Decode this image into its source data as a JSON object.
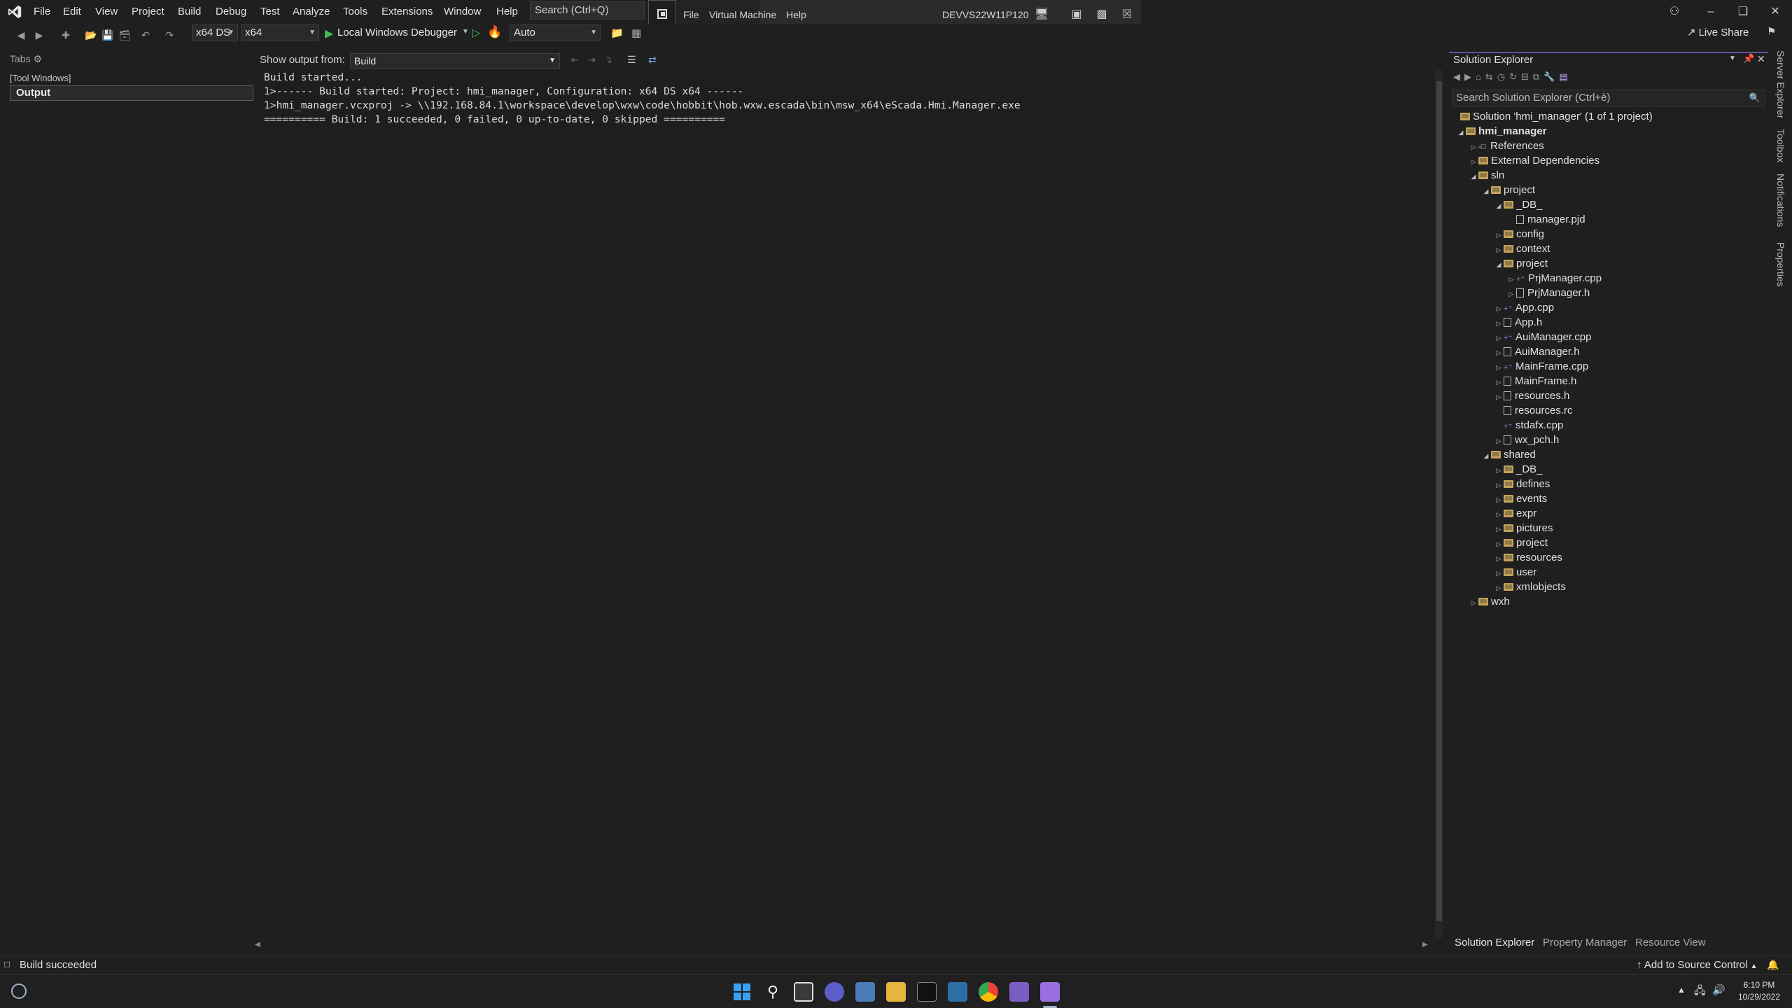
{
  "menu": [
    "File",
    "Edit",
    "View",
    "Project",
    "Build",
    "Debug",
    "Test",
    "Analyze",
    "Tools",
    "Extensions",
    "Window",
    "Help"
  ],
  "search": {
    "placeholder": "Search (Ctrl+Q)"
  },
  "vm_bar": {
    "items": [
      "File",
      "Virtual Machine",
      "Help"
    ],
    "machine_name": "DEVVS22W11P120"
  },
  "toolbar": {
    "config": "x64 DS",
    "platform": "x64",
    "debugger": "Local Windows Debugger",
    "mode": "Auto",
    "live_share": "Live Share"
  },
  "tabs_panel": {
    "title": "Tabs",
    "items": [
      "[Tool Windows]",
      "Output"
    ]
  },
  "output": {
    "show_from_label": "Show output from:",
    "source": "Build",
    "lines": [
      "Build started...",
      "1>------ Build started: Project: hmi_manager, Configuration: x64 DS x64 ------",
      "1>hmi_manager.vcxproj -> \\\\192.168.84.1\\workspace\\develop\\wxw\\code\\hobbit\\hob.wxw.escada\\bin\\msw_x64\\eScada.Hmi.Manager.exe",
      "========== Build: 1 succeeded, 0 failed, 0 up-to-date, 0 skipped =========="
    ]
  },
  "solution_explorer": {
    "title": "Solution Explorer",
    "search_placeholder": "Search Solution Explorer (Ctrl+è)",
    "tree": [
      {
        "label": "Solution 'hmi_manager' (1 of 1 project)",
        "indent": 0,
        "type": "solution",
        "expand": ""
      },
      {
        "label": "hmi_manager",
        "indent": 0,
        "type": "project",
        "expand": "open",
        "bold": true
      },
      {
        "label": "References",
        "indent": 1,
        "type": "ref",
        "expand": "closed"
      },
      {
        "label": "External Dependencies",
        "indent": 1,
        "type": "folder",
        "expand": "closed"
      },
      {
        "label": "sln",
        "indent": 1,
        "type": "folder",
        "expand": "open"
      },
      {
        "label": "project",
        "indent": 2,
        "type": "folder",
        "expand": "open"
      },
      {
        "label": "_DB_",
        "indent": 3,
        "type": "folder",
        "expand": "open"
      },
      {
        "label": "manager.pjd",
        "indent": 4,
        "type": "file",
        "expand": ""
      },
      {
        "label": "config",
        "indent": 3,
        "type": "folder",
        "expand": "closed"
      },
      {
        "label": "context",
        "indent": 3,
        "type": "folder",
        "expand": "closed"
      },
      {
        "label": "project",
        "indent": 3,
        "type": "folder",
        "expand": "open"
      },
      {
        "label": "PrjManager.cpp",
        "indent": 4,
        "type": "cpp",
        "expand": "closed"
      },
      {
        "label": "PrjManager.h",
        "indent": 4,
        "type": "file",
        "expand": "closed"
      },
      {
        "label": "App.cpp",
        "indent": 3,
        "type": "cpp",
        "expand": "closed"
      },
      {
        "label": "App.h",
        "indent": 3,
        "type": "file",
        "expand": "closed"
      },
      {
        "label": "AuiManager.cpp",
        "indent": 3,
        "type": "cpp",
        "expand": "closed"
      },
      {
        "label": "AuiManager.h",
        "indent": 3,
        "type": "file",
        "expand": "closed"
      },
      {
        "label": "MainFrame.cpp",
        "indent": 3,
        "type": "cpp",
        "expand": "closed"
      },
      {
        "label": "MainFrame.h",
        "indent": 3,
        "type": "file",
        "expand": "closed"
      },
      {
        "label": "resources.h",
        "indent": 3,
        "type": "file",
        "expand": "closed"
      },
      {
        "label": "resources.rc",
        "indent": 3,
        "type": "file",
        "expand": ""
      },
      {
        "label": "stdafx.cpp",
        "indent": 3,
        "type": "cpp",
        "expand": ""
      },
      {
        "label": "wx_pch.h",
        "indent": 3,
        "type": "file",
        "expand": "closed"
      },
      {
        "label": "shared",
        "indent": 2,
        "type": "folder",
        "expand": "open"
      },
      {
        "label": "_DB_",
        "indent": 3,
        "type": "folder",
        "expand": "closed"
      },
      {
        "label": "defines",
        "indent": 3,
        "type": "folder",
        "expand": "closed"
      },
      {
        "label": "events",
        "indent": 3,
        "type": "folder",
        "expand": "closed"
      },
      {
        "label": "expr",
        "indent": 3,
        "type": "folder",
        "expand": "closed"
      },
      {
        "label": "pictures",
        "indent": 3,
        "type": "folder",
        "expand": "closed"
      },
      {
        "label": "project",
        "indent": 3,
        "type": "folder",
        "expand": "closed"
      },
      {
        "label": "resources",
        "indent": 3,
        "type": "folder",
        "expand": "closed"
      },
      {
        "label": "user",
        "indent": 3,
        "type": "folder",
        "expand": "closed"
      },
      {
        "label": "xmlobjects",
        "indent": 3,
        "type": "folder",
        "expand": "closed"
      },
      {
        "label": "wxh",
        "indent": 1,
        "type": "folder",
        "expand": "closed"
      }
    ],
    "bottom_tabs": [
      "Solution Explorer",
      "Property Manager",
      "Resource View"
    ]
  },
  "right_rail": [
    "Server Explorer",
    "Toolbox",
    "Notifications",
    "Properties"
  ],
  "status": {
    "text": "Build succeeded",
    "source_control": "Add to Source Control"
  },
  "clock": {
    "time": "6:10 PM",
    "date": "10/29/2022"
  },
  "colors": {
    "accent": "#6a4fa3",
    "background": "#1f1f1f",
    "text": "#cccccc"
  }
}
